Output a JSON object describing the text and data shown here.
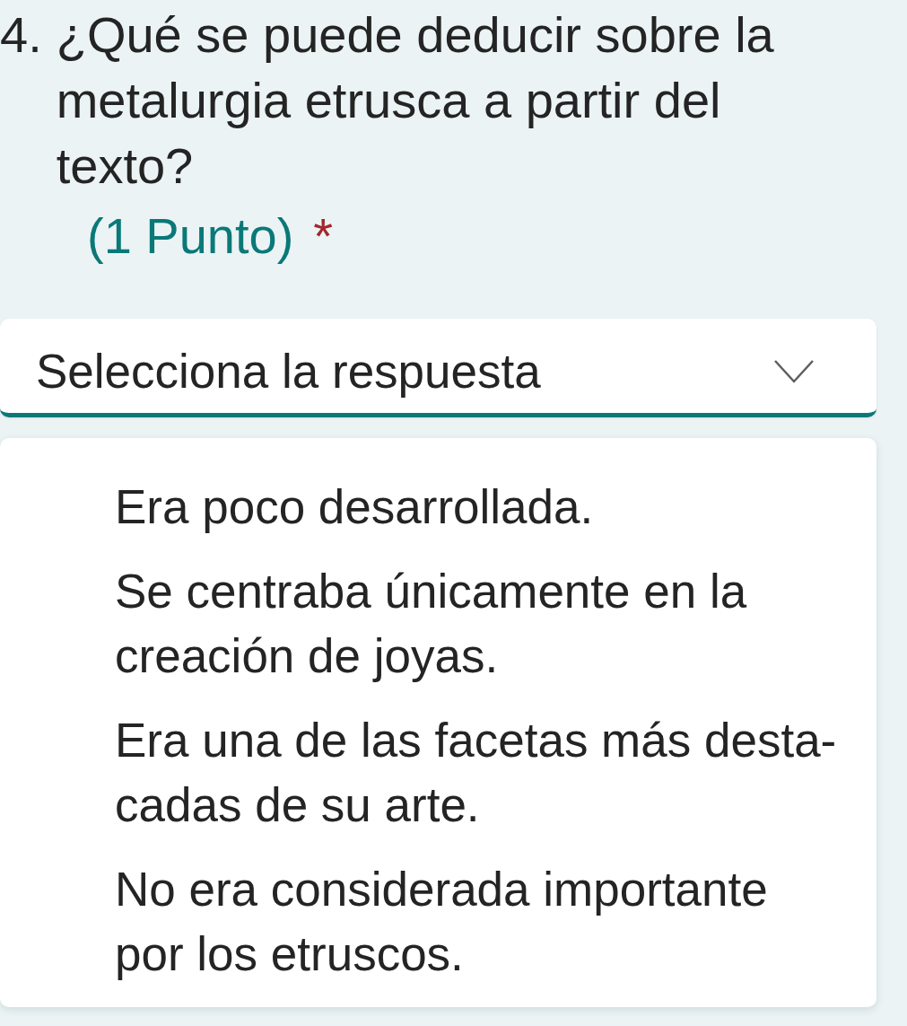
{
  "question": {
    "number": "4.",
    "text": "¿Qué se puede deducir sobre la metalurgia etrusca a partir del texto?",
    "points": "(1 Punto)",
    "required": true,
    "required_mark": "*"
  },
  "dropdown": {
    "placeholder": "Selecciona la respuesta",
    "expanded": true
  },
  "options": [
    {
      "label": "Era poco desarrollada.",
      "selected": false
    },
    {
      "label": "Se centraba únicamente en la creación de joyas.",
      "selected": false
    },
    {
      "label": "Era una de las facetas más desta-cadas de su arte.",
      "selected": false
    },
    {
      "label": "No era considerada importante por los etruscos.",
      "selected": false
    }
  ]
}
